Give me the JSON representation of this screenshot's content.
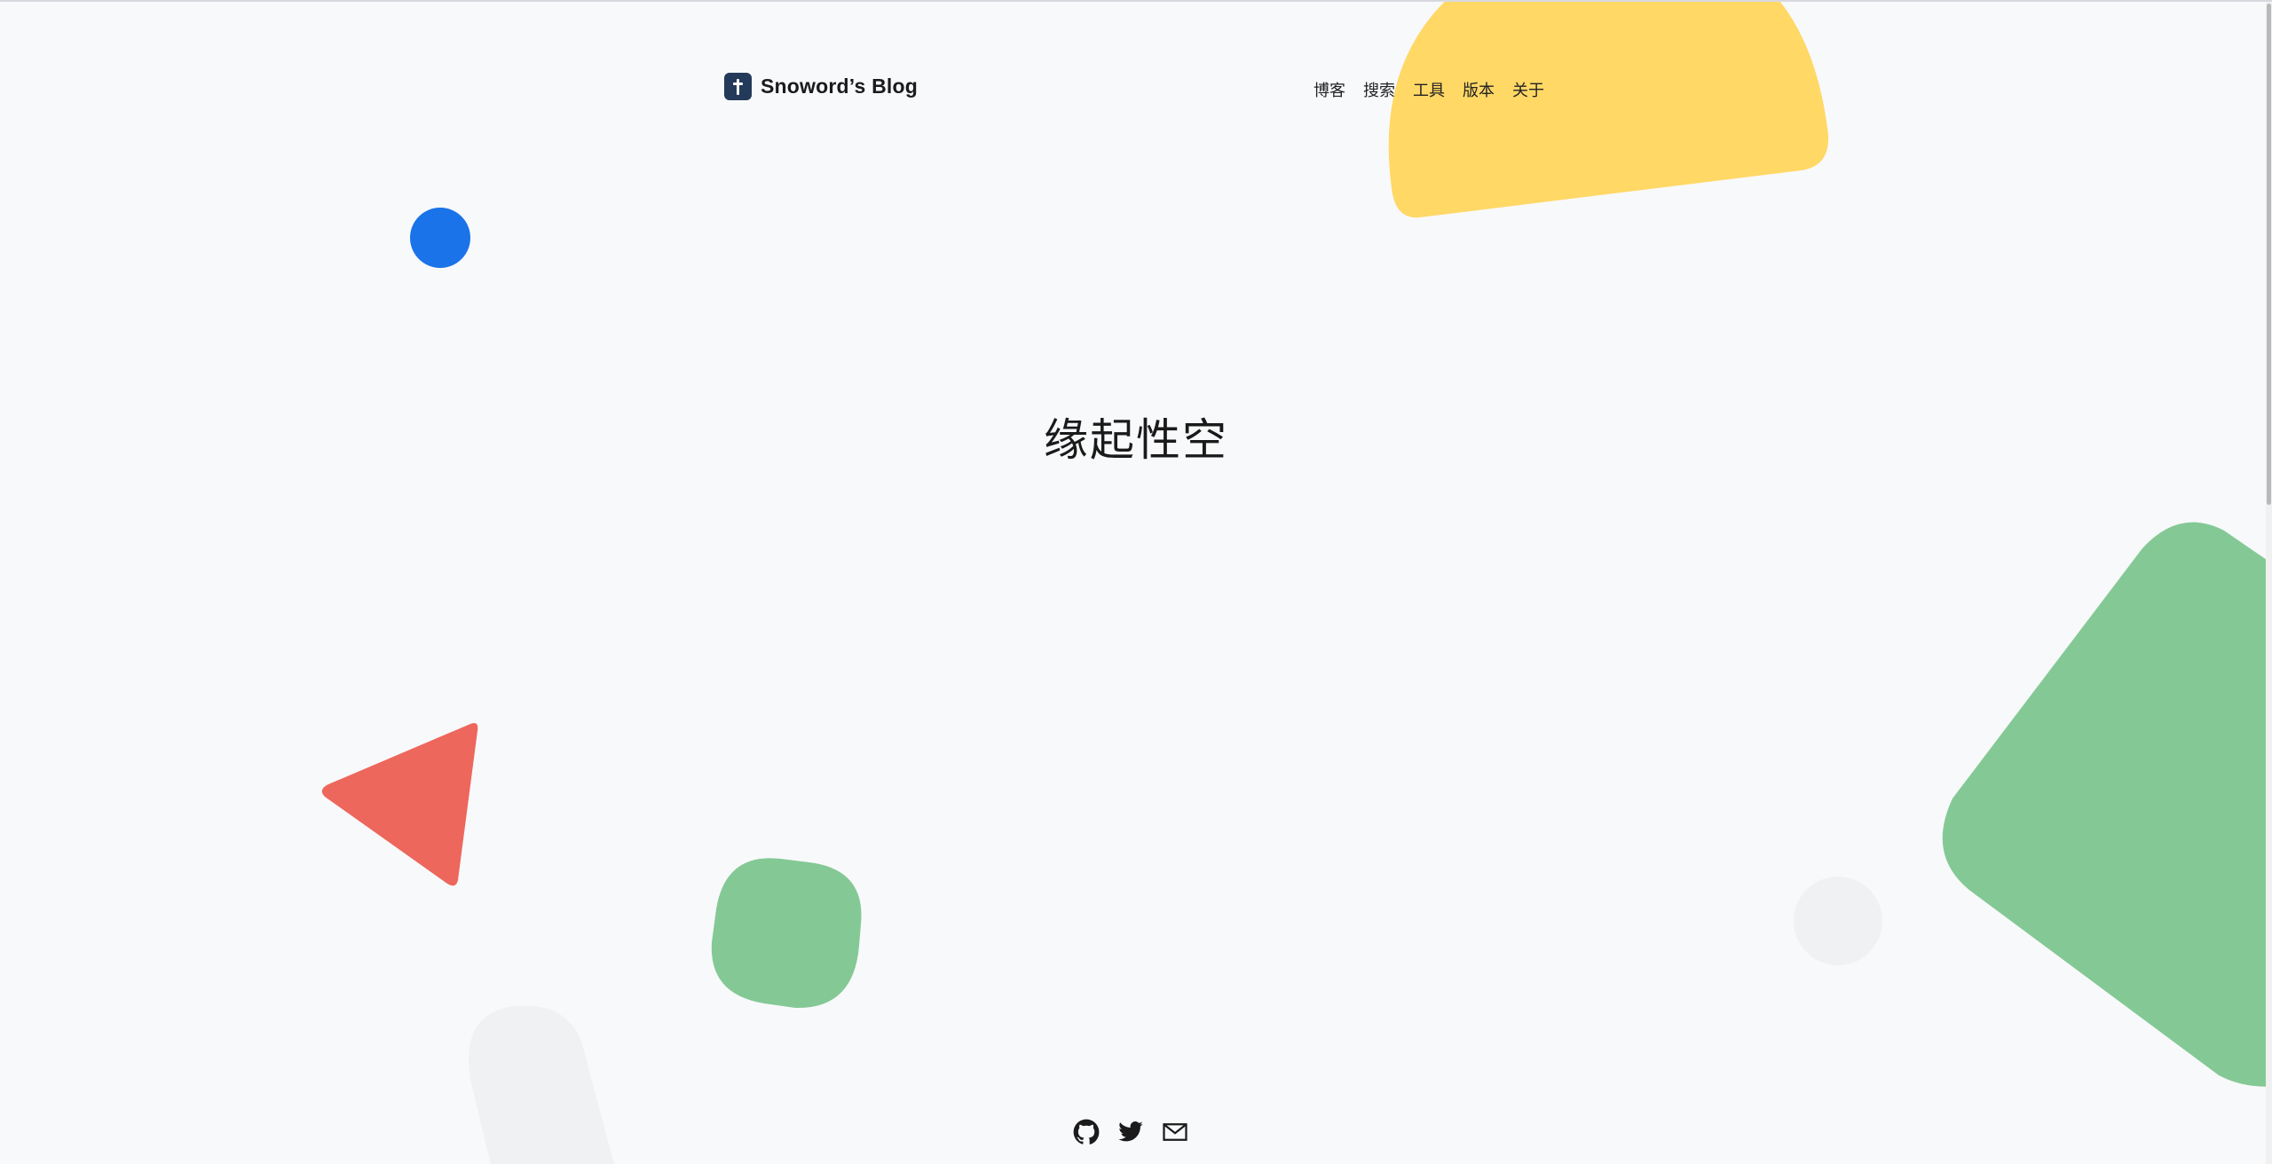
{
  "brand": {
    "title": "Snoword’s Blog",
    "logo_icon": "pen-logo-icon"
  },
  "nav": {
    "items": [
      {
        "label": "博客"
      },
      {
        "label": "搜索"
      },
      {
        "label": "工具"
      },
      {
        "label": "版本"
      },
      {
        "label": "关于"
      }
    ]
  },
  "hero": {
    "title": "缘起性空"
  },
  "footer": {
    "icons": [
      "github-icon",
      "twitter-icon",
      "mail-icon"
    ]
  },
  "colors": {
    "background": "#f8f9fb",
    "yellow": "#ffd866",
    "blue": "#1a73e8",
    "red": "#ee675c",
    "green": "#84c995",
    "light_gray": "#f0f1f3"
  }
}
